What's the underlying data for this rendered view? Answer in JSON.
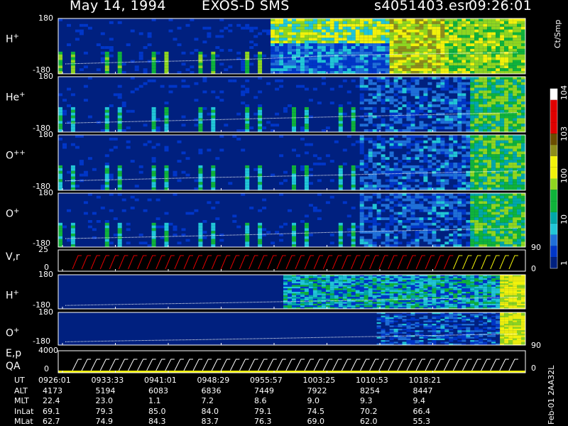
{
  "header": {
    "date": "May 14, 1994",
    "instrument": "EXOS-D SMS",
    "file": "s4051403.esr",
    "start_time": "09:26:01"
  },
  "colors": {
    "background": "#000000",
    "navy": "#00207f",
    "blue": "#0036c8",
    "mid_blue": "#1f6fd8",
    "cyan": "#21c6d6",
    "teal": "#00a8a8",
    "green": "#0fb33a",
    "lime": "#8fd61f",
    "yellow": "#f2f20a",
    "olive": "#8d8d1a",
    "brown": "#6b4d00",
    "red": "#e00000",
    "white": "#ffffff"
  },
  "colorbar": {
    "unit": "Ct/Smp",
    "ticks": [
      "10^4",
      "10^3",
      "100",
      "10",
      "1"
    ],
    "tick_values": [
      10000,
      1000,
      100,
      10,
      1
    ],
    "range": [
      1,
      10000
    ],
    "scale": "log"
  },
  "chart_data": {
    "type": "heatmap",
    "x_ticks": [
      "0926:01",
      "0933:33",
      "0941:01",
      "0948:29",
      "0955:57",
      "1003:25",
      "1010:53",
      "1018:21"
    ],
    "panels": [
      {
        "id": "h_plus_1",
        "label": "H",
        "label_sup": "+",
        "y_top": "180",
        "y_bottom": "-180",
        "ylim": [
          -180,
          180
        ],
        "color_pattern": "h1",
        "pitch_line": [
          40,
          47,
          53,
          60,
          72,
          78,
          82,
          85
        ]
      },
      {
        "id": "he_plus",
        "label": "He",
        "label_sup": "+",
        "y_top": "180",
        "y_bottom": "-180",
        "ylim": [
          -180,
          180
        ],
        "color_pattern": "he",
        "pitch_line": [
          36,
          42,
          48,
          54,
          60,
          66,
          72,
          78
        ]
      },
      {
        "id": "o_pp",
        "label": "O",
        "label_sup": "++",
        "y_top": "180",
        "y_bottom": "-180",
        "ylim": [
          -180,
          180
        ],
        "color_pattern": "opp",
        "pitch_line": [
          38,
          44,
          50,
          55,
          60,
          66,
          72,
          78
        ]
      },
      {
        "id": "o_plus_1",
        "label": "O",
        "label_sup": "+",
        "y_top": "180",
        "y_bottom": "-180",
        "ylim": [
          -180,
          180
        ],
        "right_tick": "90",
        "color_pattern": "o1",
        "pitch_line": [
          35,
          40,
          46,
          52,
          60,
          66,
          72,
          78
        ]
      },
      {
        "id": "v_r",
        "label": "V,r",
        "label_sup": "",
        "y_top": "25",
        "y_bottom": "0",
        "ylim": [
          0,
          25
        ],
        "right_tick": "0",
        "color_pattern": "vr"
      },
      {
        "id": "h_plus_2",
        "label": "H",
        "label_sup": "+",
        "y_top": "180",
        "y_bottom": "-180",
        "ylim": [
          -180,
          180
        ],
        "color_pattern": "h2",
        "pitch_line": [
          22,
          30,
          36,
          44,
          52,
          60,
          68,
          76
        ]
      },
      {
        "id": "o_plus_2",
        "label": "O",
        "label_sup": "+",
        "y_top": "180",
        "y_bottom": "-180",
        "ylim": [
          -180,
          180
        ],
        "right_tick": "90",
        "color_pattern": "o2",
        "pitch_line": [
          22,
          30,
          36,
          44,
          52,
          60,
          68,
          76
        ]
      },
      {
        "id": "e_p",
        "label": "E,p",
        "label2": "QA",
        "label_sup": "",
        "y_top": "4000",
        "y_bottom": "0",
        "ylim": [
          0,
          4000
        ],
        "right_tick": "0",
        "color_pattern": "ep"
      }
    ],
    "ephemeris": {
      "rows": [
        {
          "name": "UT",
          "values": [
            "0926:01",
            "0933:33",
            "0941:01",
            "0948:29",
            "0955:57",
            "1003:25",
            "1010:53",
            "1018:21"
          ]
        },
        {
          "name": "ALT",
          "values": [
            "4173",
            "5194",
            "6083",
            "6836",
            "7449",
            "7922",
            "8254",
            "8447"
          ]
        },
        {
          "name": "MLT",
          "values": [
            "22.4",
            "23.0",
            "1.1",
            "7.2",
            "8.6",
            "9.0",
            "9.3",
            "9.4"
          ]
        },
        {
          "name": "InLat",
          "values": [
            "69.1",
            "79.3",
            "85.0",
            "84.0",
            "79.1",
            "74.5",
            "70.2",
            "66.4"
          ]
        },
        {
          "name": "MLat",
          "values": [
            "62.7",
            "74.9",
            "84.3",
            "83.7",
            "76.3",
            "69.0",
            "62.0",
            "55.3"
          ]
        }
      ]
    }
  },
  "footer": {
    "side_label": "Feb-01  2AA32L"
  }
}
